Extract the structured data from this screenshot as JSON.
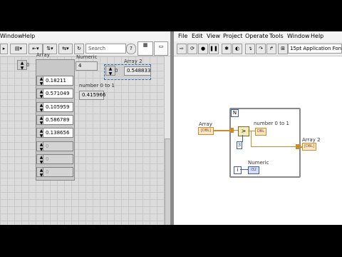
{
  "front_panel": {
    "menu": [
      "Window",
      "Help"
    ],
    "search": {
      "placeholder": "Search"
    },
    "array": {
      "label": "Array",
      "index": "0",
      "values": [
        "0.18211",
        "0.571049",
        "0.105959",
        "0.586789",
        "0.138656",
        "0",
        "0",
        "0"
      ]
    },
    "numeric": {
      "label": "Numeric",
      "value": "4"
    },
    "array2": {
      "label": "Array 2",
      "index": "0",
      "value": "0.548833"
    },
    "number_0_to_1": {
      "label": "number 0 to 1",
      "value": "0.415966"
    }
  },
  "block_diagram": {
    "menu": [
      "File",
      "Edit",
      "View",
      "Project",
      "Operate",
      "Tools",
      "Window",
      "Help"
    ],
    "font": "15pt Application Font",
    "loop_label": "N",
    "nodes": {
      "array_label": "Array",
      "array_terminal": "[DBL]",
      "number_label": "number 0 to 1",
      "number_terminal": "DBL",
      "constant": "3",
      "array2_label": "Array 2",
      "array2_terminal": "[DBL]",
      "numeric_label": "Numeric",
      "numeric_terminal": "I32",
      "iteration": "i"
    }
  },
  "colors": {
    "wire_double": "#d08a2a",
    "wire_int": "#3a5bb8",
    "grid": "#dcdcdc"
  }
}
